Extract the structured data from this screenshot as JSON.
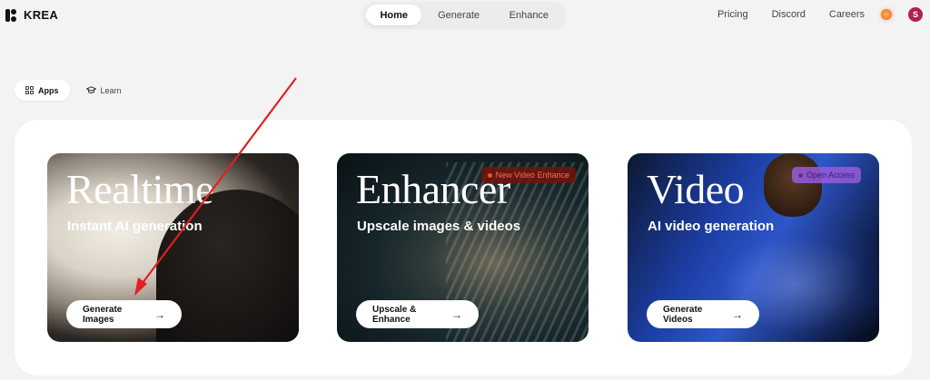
{
  "header": {
    "brand": "KREA",
    "tabs": [
      "Home",
      "Generate",
      "Enhance"
    ],
    "links": {
      "pricing": "Pricing",
      "discord": "Discord",
      "careers": "Careers"
    },
    "avatar_initial": "S"
  },
  "subtabs": {
    "apps": "Apps",
    "learn": "Learn"
  },
  "cards": [
    {
      "title": "Realtime",
      "subtitle": "Instant AI generation",
      "button": "Generate Images",
      "badge": ""
    },
    {
      "title": "Enhancer",
      "subtitle": "Upscale images & videos",
      "button": "Upscale & Enhance",
      "badge": "New Video Enhance"
    },
    {
      "title": "Video",
      "subtitle": "AI video generation",
      "button": "Generate Videos",
      "badge": "Open Access"
    }
  ],
  "colors": {
    "accent_red": "#e02020",
    "avatar": "#b0204a"
  },
  "icons": [
    "krea-logo-icon",
    "sun-icon",
    "grid-icon",
    "graduation-cap-icon",
    "arrow-right-icon"
  ]
}
